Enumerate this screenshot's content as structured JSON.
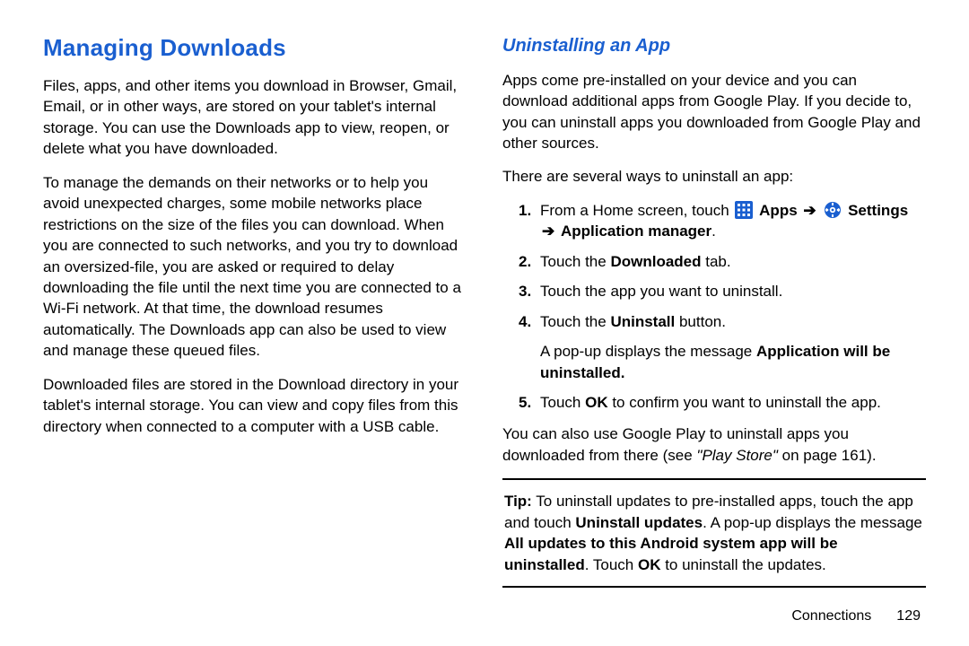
{
  "left": {
    "heading": "Managing Downloads",
    "p1": "Files, apps, and other items you download in Browser, Gmail, Email, or in other ways, are stored on your tablet's internal storage. You can use the Downloads app to view, reopen, or delete what you have downloaded.",
    "p2": "To manage the demands on their networks or to help you avoid unexpected charges, some mobile networks place restrictions on the size of the files you can download. When you are connected to such networks, and you try to download an oversized-file, you are asked or required to delay downloading the file until the next time you are connected to a Wi-Fi network. At that time, the download resumes automatically. The Downloads app can also be used to view and manage these queued files.",
    "p3": "Downloaded files are stored in the Download directory in your tablet's internal storage. You can view and copy files from this directory when connected to a computer with a USB cable."
  },
  "right": {
    "subheading": "Uninstalling an App",
    "p1": "Apps come pre-installed on your device and you can download additional apps from Google Play. If you decide to, you can uninstall apps you downloaded from Google Play and other sources.",
    "p2": "There are several ways to uninstall an app:",
    "steps": {
      "s1_num": "1.",
      "s1_a": "From a Home screen, touch ",
      "s1_apps": " Apps",
      "s1_arrow1": " ➔ ",
      "s1_settings": " Settings",
      "s1_arrow2": "➔ ",
      "s1_appmgr": "Application manager",
      "s1_end": ".",
      "s2_num": "2.",
      "s2_a": "Touch the ",
      "s2_b": "Downloaded",
      "s2_c": " tab.",
      "s3_num": "3.",
      "s3": "Touch the app you want to uninstall.",
      "s4_num": "4.",
      "s4_a": "Touch the ",
      "s4_b": "Uninstall",
      "s4_c": " button.",
      "s4n_a": "A pop-up displays the message ",
      "s4n_b": "Application will be uninstalled.",
      "s5_num": "5.",
      "s5_a": "Touch ",
      "s5_b": "OK",
      "s5_c": " to confirm you want to uninstall the app."
    },
    "p3_a": "You can also use Google Play to uninstall apps you downloaded from there (see ",
    "p3_b": "\"Play Store\"",
    "p3_c": " on page 161).",
    "tip": {
      "prefix": "Tip:",
      "a": " To uninstall updates to pre-installed apps, touch the app and touch ",
      "b": "Uninstall updates",
      "c": ". A pop-up displays the message ",
      "d": "All updates to this Android system app will be uninstalled",
      "e": ". Touch ",
      "f": "OK",
      "g": " to uninstall the updates."
    }
  },
  "footer": {
    "label": "Connections",
    "page": "129"
  }
}
